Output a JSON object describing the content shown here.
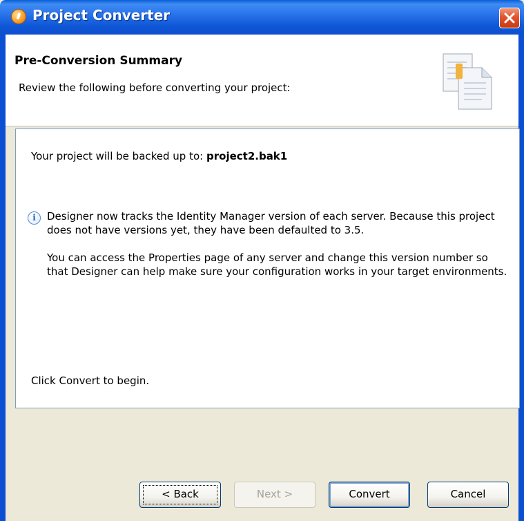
{
  "window": {
    "title": "Project Converter"
  },
  "header": {
    "title": "Pre-Conversion Summary",
    "subtitle": "Review the following before converting your project:"
  },
  "content": {
    "backup_prefix": "Your project will be backed up to:",
    "backup_file": "project2.bak1",
    "info_paragraph_1": "Designer now tracks the Identity Manager version of each server. Because this project does not have versions yet, they have been defaulted to 3.5.",
    "info_paragraph_2": "You can access the Properties page of any server and change this version number so that Designer can help make sure your configuration works in your target environments.",
    "begin_text": "Click Convert to begin."
  },
  "buttons": {
    "back": "< Back",
    "next": "Next >",
    "convert": "Convert",
    "cancel": "Cancel"
  },
  "colors": {
    "titlebar_blue": "#0d4fcf",
    "dialog_bg": "#ece9d8",
    "close_red": "#e2542d"
  },
  "icons": {
    "app": "project-converter-icon",
    "close": "close-icon",
    "header": "documents-icon",
    "info": "info-icon"
  }
}
